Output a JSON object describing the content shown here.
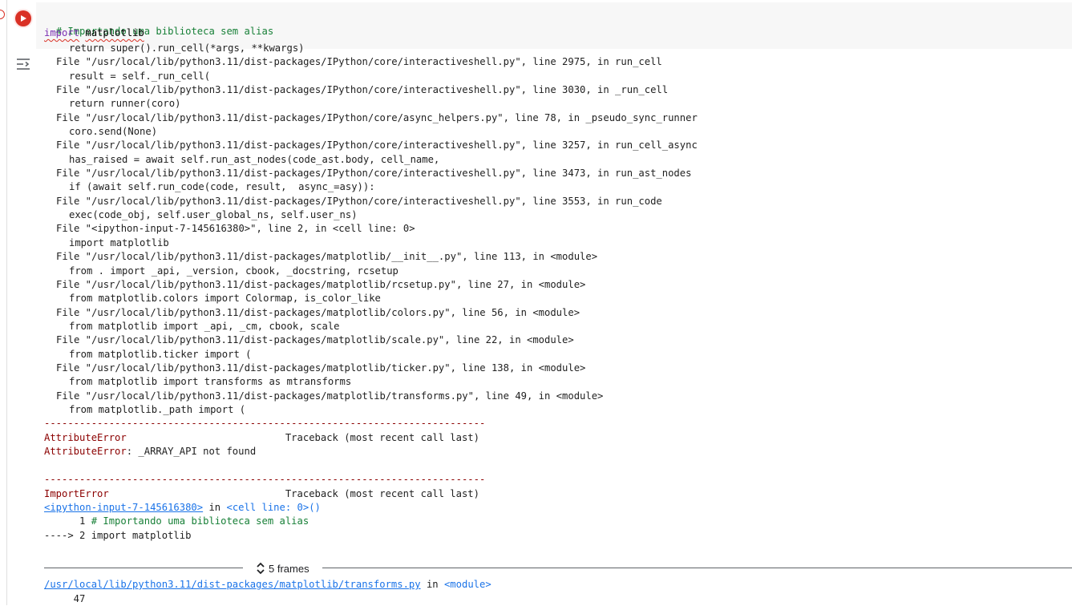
{
  "code": {
    "comment": "# Importando uma biblioteca sem alias",
    "keyword": "import",
    "module": "matplotlib"
  },
  "traceback_lines": [
    {
      "indent": 2,
      "text": "return super().run_cell(*args, **kwargs)"
    },
    {
      "indent": 1,
      "text": "File \"/usr/local/lib/python3.11/dist-packages/IPython/core/interactiveshell.py\", line 2975, in run_cell"
    },
    {
      "indent": 2,
      "text": "result = self._run_cell("
    },
    {
      "indent": 1,
      "text": "File \"/usr/local/lib/python3.11/dist-packages/IPython/core/interactiveshell.py\", line 3030, in _run_cell"
    },
    {
      "indent": 2,
      "text": "return runner(coro)"
    },
    {
      "indent": 1,
      "text": "File \"/usr/local/lib/python3.11/dist-packages/IPython/core/async_helpers.py\", line 78, in _pseudo_sync_runner"
    },
    {
      "indent": 2,
      "text": "coro.send(None)"
    },
    {
      "indent": 1,
      "text": "File \"/usr/local/lib/python3.11/dist-packages/IPython/core/interactiveshell.py\", line 3257, in run_cell_async"
    },
    {
      "indent": 2,
      "text": "has_raised = await self.run_ast_nodes(code_ast.body, cell_name,"
    },
    {
      "indent": 1,
      "text": "File \"/usr/local/lib/python3.11/dist-packages/IPython/core/interactiveshell.py\", line 3473, in run_ast_nodes"
    },
    {
      "indent": 2,
      "text": "if (await self.run_code(code, result,  async_=asy)):"
    },
    {
      "indent": 1,
      "text": "File \"/usr/local/lib/python3.11/dist-packages/IPython/core/interactiveshell.py\", line 3553, in run_code"
    },
    {
      "indent": 2,
      "text": "exec(code_obj, self.user_global_ns, self.user_ns)"
    },
    {
      "indent": 1,
      "text": "File \"<ipython-input-7-145616380>\", line 2, in <cell line: 0>"
    },
    {
      "indent": 2,
      "text": "import matplotlib"
    },
    {
      "indent": 1,
      "text": "File \"/usr/local/lib/python3.11/dist-packages/matplotlib/__init__.py\", line 113, in <module>"
    },
    {
      "indent": 2,
      "text": "from . import _api, _version, cbook, _docstring, rcsetup"
    },
    {
      "indent": 1,
      "text": "File \"/usr/local/lib/python3.11/dist-packages/matplotlib/rcsetup.py\", line 27, in <module>"
    },
    {
      "indent": 2,
      "text": "from matplotlib.colors import Colormap, is_color_like"
    },
    {
      "indent": 1,
      "text": "File \"/usr/local/lib/python3.11/dist-packages/matplotlib/colors.py\", line 56, in <module>"
    },
    {
      "indent": 2,
      "text": "from matplotlib import _api, _cm, cbook, scale"
    },
    {
      "indent": 1,
      "text": "File \"/usr/local/lib/python3.11/dist-packages/matplotlib/scale.py\", line 22, in <module>"
    },
    {
      "indent": 2,
      "text": "from matplotlib.ticker import ("
    },
    {
      "indent": 1,
      "text": "File \"/usr/local/lib/python3.11/dist-packages/matplotlib/ticker.py\", line 138, in <module>"
    },
    {
      "indent": 2,
      "text": "from matplotlib import transforms as mtransforms"
    },
    {
      "indent": 1,
      "text": "File \"/usr/local/lib/python3.11/dist-packages/matplotlib/transforms.py\", line 49, in <module>"
    },
    {
      "indent": 2,
      "text": "from matplotlib._path import ("
    }
  ],
  "separator": "---------------------------------------------------------------------------",
  "attribute_error": {
    "name": "AttributeError",
    "traceback_header": "                           Traceback (most recent call last)",
    "message_name": "AttributeError",
    "message": ": _ARRAY_API not found"
  },
  "import_error": {
    "name": "ImportError",
    "traceback_header": "                              Traceback (most recent call last)",
    "input_link": "<ipython-input-7-145616380>",
    "in_text": " in ",
    "cell_ref": "<cell line: 0>()",
    "src_line1_prefix": "      1 ",
    "src_line1_comment": "# Importando uma biblioteca sem alias",
    "src_line2": "----> 2 import matplotlib"
  },
  "frames_label": "5 frames",
  "bottom": {
    "path_link": "/usr/local/lib/python3.11/dist-packages/matplotlib/transforms.py",
    "in_text": " in ",
    "module_ref": "<module>",
    "next_line": "     47"
  }
}
